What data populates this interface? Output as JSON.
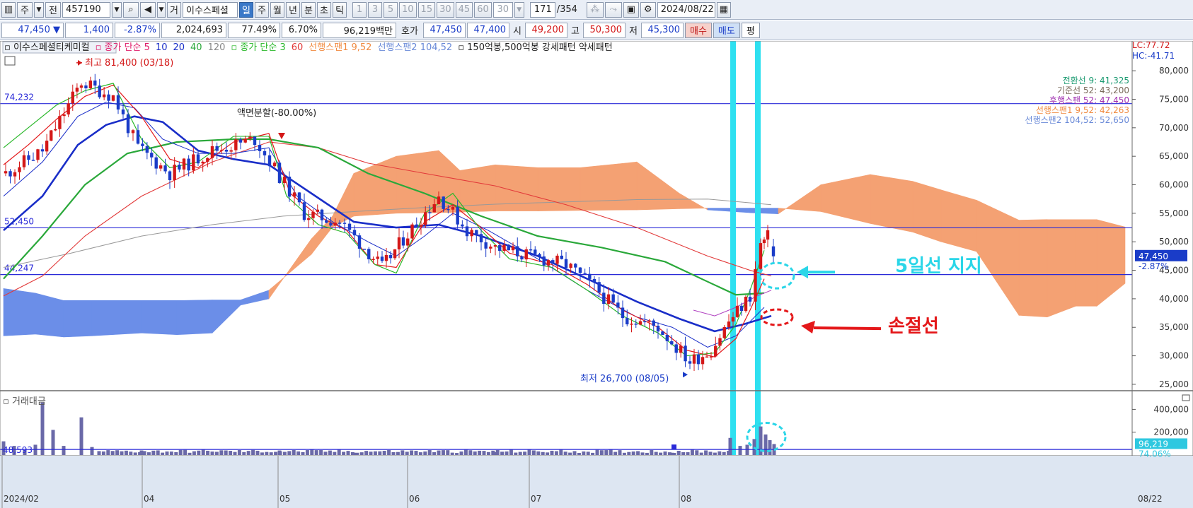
{
  "toolbar": {
    "period_unit": "주",
    "prev_label": "전",
    "code": "457190",
    "market_badge": "거",
    "stock_name": "이수스페셜",
    "period_buttons": [
      "일",
      "주",
      "월",
      "년",
      "분",
      "초",
      "틱"
    ],
    "selected_period": "일",
    "interval_buttons": [
      "1",
      "3",
      "5",
      "10",
      "15",
      "30",
      "45",
      "60"
    ],
    "interval_input": "30",
    "count": "171",
    "total": "/354",
    "date": "2024/08/22"
  },
  "quote": {
    "price": "47,450",
    "change_arrow": "▼",
    "change": "1,400",
    "change_pct": "-2.87%",
    "volume": "2,024,693",
    "volume_ratio": "77.49%",
    "turnover": "6.70%",
    "amount": "96,219백만",
    "hoga_label": "호가",
    "ask": "47,450",
    "bid": "47,400",
    "open_label": "시",
    "open": "49,200",
    "high_label": "고",
    "high": "50,300",
    "low_label": "저",
    "low": "45,300",
    "buy_label": "매수",
    "sell_label": "매도",
    "eval_label": "평"
  },
  "legend": {
    "name": "이수스페셜티케미컬",
    "ma1_prefix": "종가 단순 5",
    "ma1_rest": [
      "10",
      "20",
      "40",
      "120"
    ],
    "ma2_prefix": "종가 단순 3",
    "ma2_rest": "60",
    "span1": "선행스팬1 9,52",
    "span2": "선행스팬2 104,52",
    "pattern": "150억봉,500억봉 강세패턴  약세패턴"
  },
  "price_axis": {
    "ticks": [
      "80,000",
      "75,000",
      "70,000",
      "65,000",
      "60,000",
      "55,000",
      "50,000",
      "45,000",
      "40,000",
      "35,000",
      "30,000",
      "25,000"
    ],
    "lc": "LC:77.72",
    "hc": "HC:-41.71",
    "current_price": "47,450",
    "current_pct": "-2.87%"
  },
  "volume_axis": {
    "ticks": [
      "400,000",
      "200,000"
    ],
    "current": "96,219",
    "current_pct": "74.06%",
    "ref_value": "48,593"
  },
  "ichimoku_labels": [
    {
      "text": "전환선 9: 41,325",
      "color": "#1a9a70"
    },
    {
      "text": "기준선 52: 43,200",
      "color": "#7a6a5a"
    },
    {
      "text": "후행스팬 52: 47,450",
      "color": "#a030b0"
    },
    {
      "text": "선행스팬1 9,52: 42,263",
      "color": "#f08a40"
    },
    {
      "text": "선행스팬2 104,52: 52,650",
      "color": "#6a8ad8"
    }
  ],
  "hline_labels": [
    "74,232",
    "52,450",
    "44,247"
  ],
  "annotations": {
    "high": "최고 81,400 (03/18)",
    "split": "액면분할(-80.00%)",
    "low": "최저 26,700 (08/05)",
    "support": "5일선 지지",
    "stoploss": "손절선"
  },
  "volume_pane_title": "거래대금",
  "x_axis": {
    "labels": [
      "2024/02",
      "04",
      "05",
      "06",
      "07",
      "08"
    ],
    "end_label": "08/22"
  },
  "colors": {
    "up": "#d41818",
    "down": "#1a3cc8",
    "ma5": "#e4181a",
    "cloud_orange": "#f4a173",
    "cloud_blue": "#6b8ee8",
    "highlight": "#2ee0f0",
    "annotation_cyan": "#2bd6e8",
    "annotation_red": "#e4181a"
  },
  "chart_data": {
    "type": "candlestick",
    "y_range": [
      24000,
      82000
    ],
    "horizontal_lines": [
      74232,
      52450,
      44247
    ],
    "key_points": {
      "high": {
        "date": "03/18",
        "value": 81400
      },
      "low": {
        "date": "08/05",
        "value": 26700
      },
      "last": {
        "date": "08/22",
        "open": 49200,
        "high": 50300,
        "low": 45300,
        "close": 47450
      }
    },
    "ichimoku": {
      "conversion_9": 41325,
      "base_52": 43200,
      "lagging_52": 47450,
      "leading_span1": 42263,
      "leading_span2": 52650
    },
    "volume": {
      "last": 96219,
      "ratio_pct": 74.06
    }
  }
}
